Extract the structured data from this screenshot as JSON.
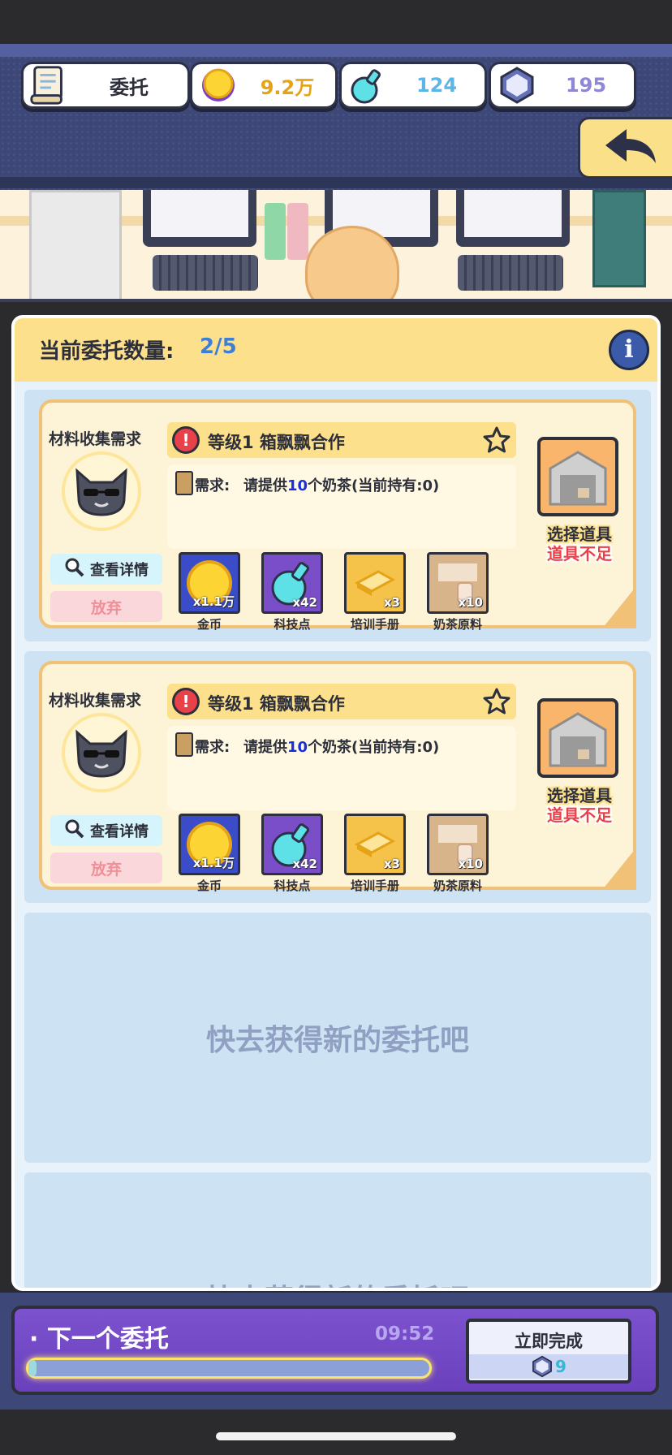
{
  "header": {
    "entrust_label": "委托",
    "gold": "9.2万",
    "tech_points": "124",
    "gems": "195"
  },
  "panel": {
    "count_label": "当前委托数量:",
    "count_value": "2/5"
  },
  "cards": [
    {
      "type": "材料收集需求",
      "title": "等级1 箱飘飘合作",
      "req_label": "需求:",
      "req_prefix": "请提供",
      "req_num": "10",
      "req_suffix": "个奶茶(当前持有:0)",
      "detail_label": "查看详情",
      "abandon_label": "放弃",
      "select_label": "选择道具",
      "lack_label": "道具不足",
      "rewards": [
        {
          "qty": "x1.1万",
          "name": "金币"
        },
        {
          "qty": "x42",
          "name": "科技点"
        },
        {
          "qty": "x3",
          "name": "培训手册"
        },
        {
          "qty": "x10",
          "name": "奶茶原料"
        }
      ]
    },
    {
      "type": "材料收集需求",
      "title": "等级1 箱飘飘合作",
      "req_label": "需求:",
      "req_prefix": "请提供",
      "req_num": "10",
      "req_suffix": "个奶茶(当前持有:0)",
      "detail_label": "查看详情",
      "abandon_label": "放弃",
      "select_label": "选择道具",
      "lack_label": "道具不足",
      "rewards": [
        {
          "qty": "x1.1万",
          "name": "金币"
        },
        {
          "qty": "x42",
          "name": "科技点"
        },
        {
          "qty": "x3",
          "name": "培训手册"
        },
        {
          "qty": "x10",
          "name": "奶茶原料"
        }
      ]
    }
  ],
  "empty_slots": [
    {
      "text": "快去获得新的委托吧"
    },
    {
      "text": "快去获得新的委托吧"
    }
  ],
  "footer": {
    "next_label": "· 下一个委托",
    "timer": "09:52",
    "progress": 0.02,
    "instant_label": "立即完成",
    "instant_cost": "9"
  },
  "colors": {
    "accent_yellow": "#fde08c",
    "warning_red": "#e8414a",
    "highlight_blue": "#1a2fd6",
    "purple": "#7248c4"
  }
}
